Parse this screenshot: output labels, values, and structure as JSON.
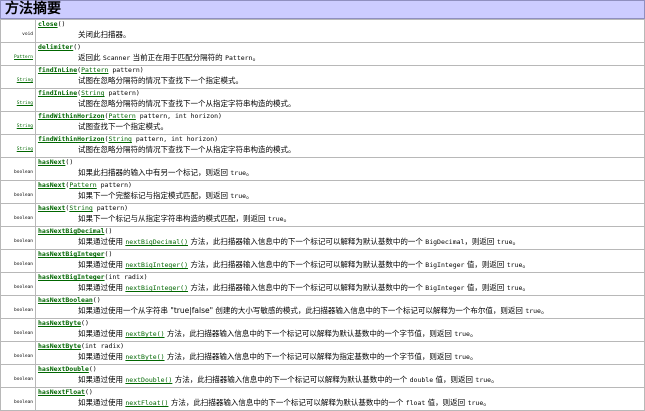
{
  "title": "方法摘要",
  "methods": [
    {
      "type": "void",
      "type_link": false,
      "name": "close",
      "params": [
        {
          "t": "text",
          "v": "()"
        }
      ],
      "summary": [
        {
          "t": "text",
          "v": "关闭此扫描器。"
        }
      ]
    },
    {
      "type": "Pattern",
      "type_link": true,
      "name": "delimiter",
      "params": [
        {
          "t": "text",
          "v": "()"
        }
      ],
      "summary": [
        {
          "t": "text",
          "v": "返回此 "
        },
        {
          "t": "code",
          "v": "Scanner"
        },
        {
          "t": "text",
          "v": " 当前正在用于匹配分隔符的 "
        },
        {
          "t": "code",
          "v": "Pattern"
        },
        {
          "t": "text",
          "v": "。"
        }
      ]
    },
    {
      "type": "String",
      "type_link": true,
      "name": "findInLine",
      "params": [
        {
          "t": "text",
          "v": "("
        },
        {
          "t": "link",
          "v": "Pattern"
        },
        {
          "t": "text",
          "v": " pattern)"
        }
      ],
      "summary": [
        {
          "t": "text",
          "v": "试图在忽略分隔符的情况下查找下一个指定模式。"
        }
      ]
    },
    {
      "type": "String",
      "type_link": true,
      "name": "findInLine",
      "params": [
        {
          "t": "text",
          "v": "("
        },
        {
          "t": "link",
          "v": "String"
        },
        {
          "t": "text",
          "v": " pattern)"
        }
      ],
      "summary": [
        {
          "t": "text",
          "v": "试图在忽略分隔符的情况下查找下一个从指定字符串构造的模式。"
        }
      ]
    },
    {
      "type": "String",
      "type_link": true,
      "name": "findWithinHorizon",
      "params": [
        {
          "t": "text",
          "v": "("
        },
        {
          "t": "link",
          "v": "Pattern"
        },
        {
          "t": "text",
          "v": " pattern, int horizon)"
        }
      ],
      "summary": [
        {
          "t": "text",
          "v": "试图查找下一个指定模式。"
        }
      ]
    },
    {
      "type": "String",
      "type_link": true,
      "name": "findWithinHorizon",
      "params": [
        {
          "t": "text",
          "v": "("
        },
        {
          "t": "link",
          "v": "String"
        },
        {
          "t": "text",
          "v": " pattern, int horizon)"
        }
      ],
      "summary": [
        {
          "t": "text",
          "v": "试图在忽略分隔符的情况下查找下一个从指定字符串构造的模式。"
        }
      ]
    },
    {
      "type": "boolean",
      "type_link": false,
      "name": "hasNext",
      "params": [
        {
          "t": "text",
          "v": "()"
        }
      ],
      "summary": [
        {
          "t": "text",
          "v": "如果此扫描器的输入中有另一个标记，则返回 "
        },
        {
          "t": "code",
          "v": "true"
        },
        {
          "t": "text",
          "v": "。"
        }
      ]
    },
    {
      "type": "boolean",
      "type_link": false,
      "name": "hasNext",
      "params": [
        {
          "t": "text",
          "v": "("
        },
        {
          "t": "link",
          "v": "Pattern"
        },
        {
          "t": "text",
          "v": " pattern)"
        }
      ],
      "summary": [
        {
          "t": "text",
          "v": "如果下一个完整标记与指定模式匹配，则返回 "
        },
        {
          "t": "code",
          "v": "true"
        },
        {
          "t": "text",
          "v": "。"
        }
      ]
    },
    {
      "type": "boolean",
      "type_link": false,
      "name": "hasNext",
      "params": [
        {
          "t": "text",
          "v": "("
        },
        {
          "t": "link",
          "v": "String"
        },
        {
          "t": "text",
          "v": " pattern)"
        }
      ],
      "summary": [
        {
          "t": "text",
          "v": "如果下一个标记与从指定字符串构造的模式匹配，则返回 "
        },
        {
          "t": "code",
          "v": "true"
        },
        {
          "t": "text",
          "v": "。"
        }
      ]
    },
    {
      "type": "boolean",
      "type_link": false,
      "name": "hasNextBigDecimal",
      "params": [
        {
          "t": "text",
          "v": "()"
        }
      ],
      "summary": [
        {
          "t": "text",
          "v": "如果通过使用 "
        },
        {
          "t": "clink",
          "v": "nextBigDecimal()"
        },
        {
          "t": "text",
          "v": " 方法，此扫描器输入信息中的下一个标记可以解释为默认基数中的一个 "
        },
        {
          "t": "code",
          "v": "BigDecimal"
        },
        {
          "t": "text",
          "v": "，则返回 "
        },
        {
          "t": "code",
          "v": "true"
        },
        {
          "t": "text",
          "v": "。"
        }
      ]
    },
    {
      "type": "boolean",
      "type_link": false,
      "name": "hasNextBigInteger",
      "params": [
        {
          "t": "text",
          "v": "()"
        }
      ],
      "summary": [
        {
          "t": "text",
          "v": "如果通过使用 "
        },
        {
          "t": "clink",
          "v": "nextBigInteger()"
        },
        {
          "t": "text",
          "v": " 方法，此扫描器输入信息中的下一个标记可以解释为默认基数中的一个 "
        },
        {
          "t": "code",
          "v": "BigInteger"
        },
        {
          "t": "text",
          "v": " 值，则返回 "
        },
        {
          "t": "code",
          "v": "true"
        },
        {
          "t": "text",
          "v": "。"
        }
      ]
    },
    {
      "type": "boolean",
      "type_link": false,
      "name": "hasNextBigInteger",
      "params": [
        {
          "t": "text",
          "v": "(int radix)"
        }
      ],
      "summary": [
        {
          "t": "text",
          "v": "如果通过使用 "
        },
        {
          "t": "clink",
          "v": "nextBigInteger()"
        },
        {
          "t": "text",
          "v": " 方法，此扫描器输入信息中的下一个标记可以解释为默认基数中的一个 "
        },
        {
          "t": "code",
          "v": "BigInteger"
        },
        {
          "t": "text",
          "v": " 值，则返回 "
        },
        {
          "t": "code",
          "v": "true"
        },
        {
          "t": "text",
          "v": "。"
        }
      ]
    },
    {
      "type": "boolean",
      "type_link": false,
      "name": "hasNextBoolean",
      "params": [
        {
          "t": "text",
          "v": "()"
        }
      ],
      "summary": [
        {
          "t": "text",
          "v": "如果通过使用一个从字符串 \"true|false\" 创建的大小写敏感的模式，此扫描器输入信息中的下一个标记可以解释为一个布尔值，则返回 "
        },
        {
          "t": "code",
          "v": "true"
        },
        {
          "t": "text",
          "v": "。"
        }
      ]
    },
    {
      "type": "boolean",
      "type_link": false,
      "name": "hasNextByte",
      "params": [
        {
          "t": "text",
          "v": "()"
        }
      ],
      "summary": [
        {
          "t": "text",
          "v": "如果通过使用 "
        },
        {
          "t": "clink",
          "v": "nextByte()"
        },
        {
          "t": "text",
          "v": " 方法，此扫描器输入信息中的下一个标记可以解释为默认基数中的一个字节值，则返回 "
        },
        {
          "t": "code",
          "v": "true"
        },
        {
          "t": "text",
          "v": "。"
        }
      ]
    },
    {
      "type": "boolean",
      "type_link": false,
      "name": "hasNextByte",
      "params": [
        {
          "t": "text",
          "v": "(int radix)"
        }
      ],
      "summary": [
        {
          "t": "text",
          "v": "如果通过使用 "
        },
        {
          "t": "clink",
          "v": "nextByte()"
        },
        {
          "t": "text",
          "v": " 方法，此扫描器输入信息中的下一个标记可以解释为指定基数中的一个字节值，则返回 "
        },
        {
          "t": "code",
          "v": "true"
        },
        {
          "t": "text",
          "v": "。"
        }
      ]
    },
    {
      "type": "boolean",
      "type_link": false,
      "name": "hasNextDouble",
      "params": [
        {
          "t": "text",
          "v": "()"
        }
      ],
      "summary": [
        {
          "t": "text",
          "v": "如果通过使用 "
        },
        {
          "t": "clink",
          "v": "nextDouble()"
        },
        {
          "t": "text",
          "v": " 方法，此扫描器输入信息中的下一个标记可以解释为默认基数中的一个 "
        },
        {
          "t": "code",
          "v": "double"
        },
        {
          "t": "text",
          "v": " 值，则返回 "
        },
        {
          "t": "code",
          "v": "true"
        },
        {
          "t": "text",
          "v": "。"
        }
      ]
    },
    {
      "type": "boolean",
      "type_link": false,
      "name": "hasNextFloat",
      "params": [
        {
          "t": "text",
          "v": "()"
        }
      ],
      "summary": [
        {
          "t": "text",
          "v": "如果通过使用 "
        },
        {
          "t": "clink",
          "v": "nextFloat()"
        },
        {
          "t": "text",
          "v": " 方法，此扫描器输入信息中的下一个标记可以解释为默认基数中的一个 "
        },
        {
          "t": "code",
          "v": "float"
        },
        {
          "t": "text",
          "v": " 值，则返回 "
        },
        {
          "t": "code",
          "v": "true"
        },
        {
          "t": "text",
          "v": "。"
        }
      ]
    }
  ]
}
